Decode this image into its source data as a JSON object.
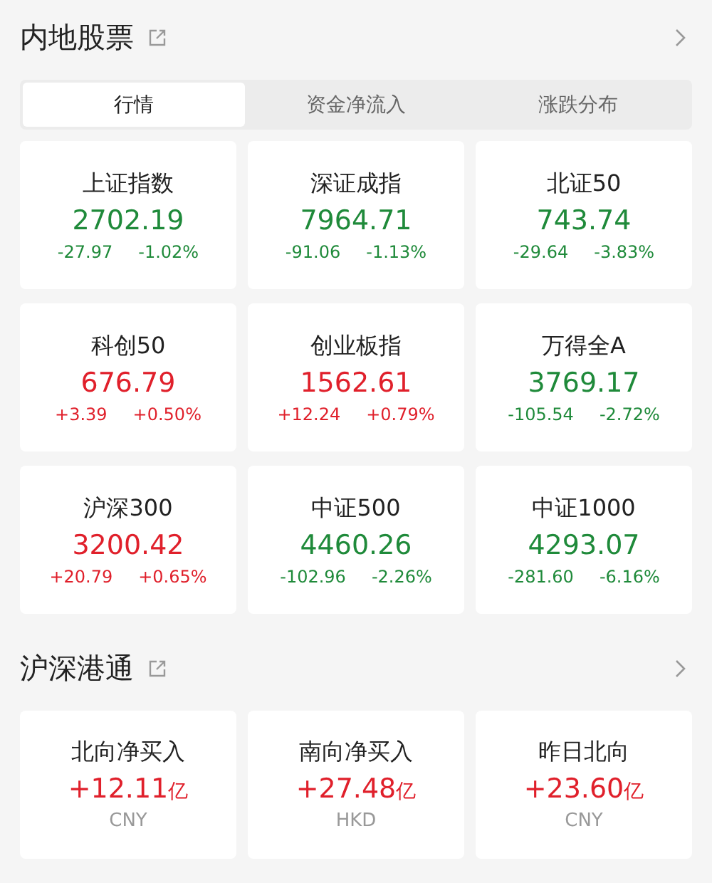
{
  "sections": [
    {
      "title": "内地股票",
      "tabs": [
        {
          "label": "行情",
          "selected": true
        },
        {
          "label": "资金净流入",
          "selected": false
        },
        {
          "label": "涨跌分布",
          "selected": false
        }
      ],
      "cards": [
        {
          "name": "上证指数",
          "value": "2702.19",
          "change": "-27.97",
          "percent": "-1.02%",
          "color": "#1f8a3a"
        },
        {
          "name": "深证成指",
          "value": "7964.71",
          "change": "-91.06",
          "percent": "-1.13%",
          "color": "#1f8a3a"
        },
        {
          "name": "北证50",
          "value": "743.74",
          "change": "-29.64",
          "percent": "-3.83%",
          "color": "#1f8a3a"
        },
        {
          "name": "科创50",
          "value": "676.79",
          "change": "+3.39",
          "percent": "+0.50%",
          "color": "#e0202b"
        },
        {
          "name": "创业板指",
          "value": "1562.61",
          "change": "+12.24",
          "percent": "+0.79%",
          "color": "#e0202b"
        },
        {
          "name": "万得全A",
          "value": "3769.17",
          "change": "-105.54",
          "percent": "-2.72%",
          "color": "#1f8a3a"
        },
        {
          "name": "沪深300",
          "value": "3200.42",
          "change": "+20.79",
          "percent": "+0.65%",
          "color": "#e0202b"
        },
        {
          "name": "中证500",
          "value": "4460.26",
          "change": "-102.96",
          "percent": "-2.26%",
          "color": "#1f8a3a"
        },
        {
          "name": "中证1000",
          "value": "4293.07",
          "change": "-281.60",
          "percent": "-6.16%",
          "color": "#1f8a3a"
        }
      ]
    },
    {
      "title": "沪深港通",
      "flows": [
        {
          "name": "北向净买入",
          "value": "+12.11",
          "unit": "亿",
          "currency": "CNY",
          "color": "#e0202b"
        },
        {
          "name": "南向净买入",
          "value": "+27.48",
          "unit": "亿",
          "currency": "HKD",
          "color": "#e0202b"
        },
        {
          "name": "昨日北向",
          "value": "+23.60",
          "unit": "亿",
          "currency": "CNY",
          "color": "#e0202b"
        }
      ]
    }
  ]
}
